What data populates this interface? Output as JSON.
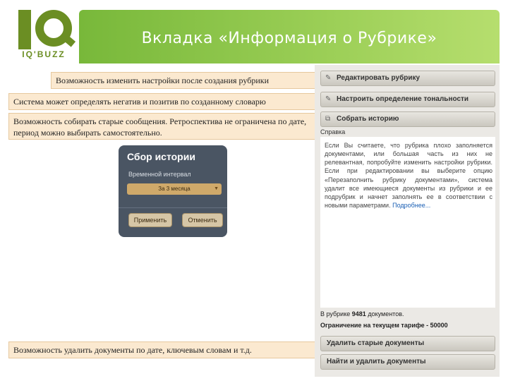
{
  "logo": {
    "text": "IQ'BUZZ"
  },
  "header": {
    "title": "Вкладка «Информация о Рубрике»"
  },
  "captions": [
    "Возможность изменить настройки после создания рубрики",
    "Система может определять негатив и позитив по созданному словарю",
    "Возможность собирать старые сообщения. Ретроспектива не ограничена по дате, период можно выбирать самостоятельно.",
    "Возможность удалить документы по дате, ключевым словам и т.д."
  ],
  "history_dialog": {
    "title": "Сбор истории",
    "interval_label": "Временной интервал",
    "interval_value": "За 3 месяца",
    "apply_label": "Применить",
    "cancel_label": "Отменить"
  },
  "right_panel": {
    "buttons": {
      "edit": "Редактировать рубрику",
      "tone": "Настроить определение тональности",
      "collect": "Собрать историю",
      "delete_old": "Удалить старые документы",
      "find_delete": "Найти и удалить документы"
    },
    "help": {
      "label": "Справка",
      "text": "Если Вы считаете, что рубрика плохо заполняется документами, или большая часть из них не релевантная, попробуйте изменить настройки рубрики. Если при редактировании вы выберите опцию «Перезаполнить рубрику документами», система удалит все имеющиеся документы из рубрики и ее подрубрик и начнет заполнять ее в соответствии с новыми параметрами.",
      "more": "Подробнее..."
    },
    "stats": {
      "docs_prefix": "В рубрике",
      "docs_count": "9481",
      "docs_suffix": "документов.",
      "limit_text": "Ограничение на текущем тарифе - 50000"
    }
  },
  "colors": {
    "banner": "#8cc44a",
    "logo": "#6b8e23",
    "caption_bg": "#fbe9d0",
    "dialog_bg": "#4a5563"
  }
}
